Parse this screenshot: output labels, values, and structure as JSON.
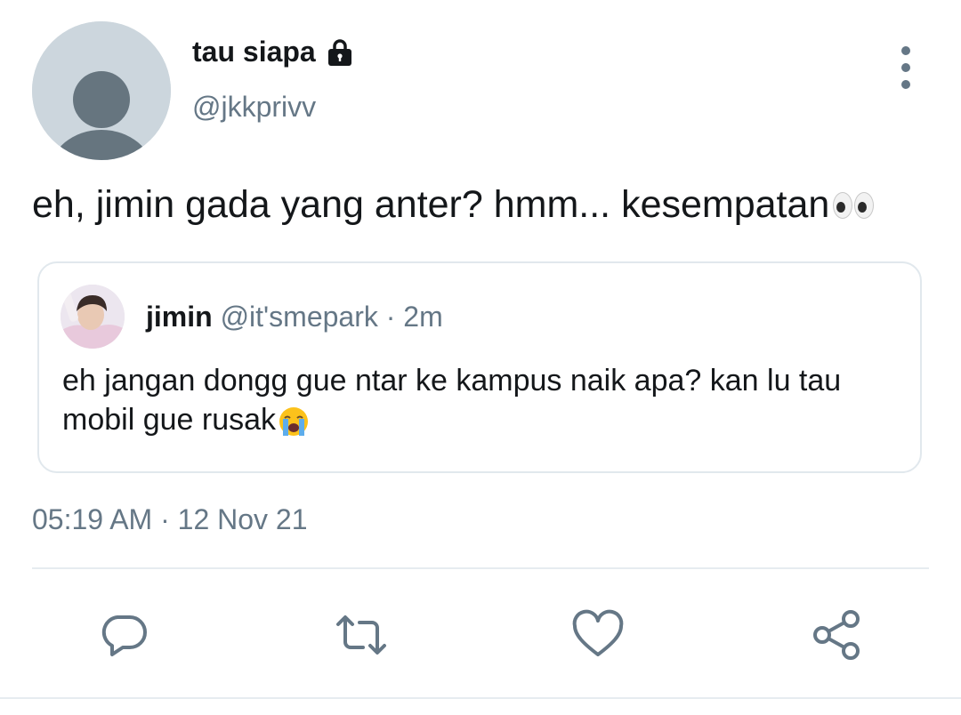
{
  "tweet": {
    "display_name": "tau siapa",
    "handle": "@jkkprivv",
    "lock_icon": "lock-icon",
    "more_icon": "more-vertical-icon",
    "text": "eh, jimin gada yang anter? hmm... kesempatan",
    "text_emoji": "eyes-emoji",
    "timestamp": "05:19 AM · 12 Nov 21"
  },
  "quote": {
    "name": "jimin",
    "handle": "@it'smepark",
    "separator": "·",
    "time": "2m",
    "text": "eh jangan dongg gue ntar ke kampus naik apa? kan lu tau mobil gue rusak",
    "text_emoji": "loudly-crying-face-emoji"
  },
  "actions": [
    {
      "name": "reply",
      "icon": "comment-icon"
    },
    {
      "name": "retweet",
      "icon": "retweet-icon"
    },
    {
      "name": "like",
      "icon": "heart-icon"
    },
    {
      "name": "share",
      "icon": "share-icon"
    }
  ],
  "colors": {
    "primary_text": "#14171a",
    "secondary_text": "#657786",
    "border": "#e1e8ed",
    "avatar_placeholder_bg": "#ccd6dd",
    "avatar_placeholder_fg": "#66757f"
  }
}
